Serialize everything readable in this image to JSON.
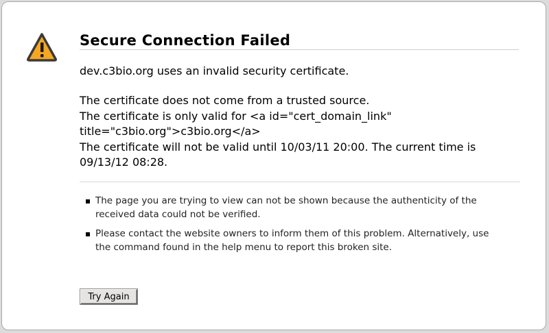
{
  "error": {
    "title": "Secure Connection Failed",
    "icon": "warning-triangle-icon",
    "short_desc": "dev.c3bio.org uses an invalid security certificate.",
    "tech_lines": [
      "The certificate does not come from a trusted source.",
      "The certificate is only valid for <a id=\"cert_domain_link\" title=\"c3bio.org\">c3bio.org</a>",
      "The certificate will not be valid until 10/03/11 20:00. The current time is 09/13/12 08:28."
    ],
    "bullets": [
      "The page you are trying to view can not be shown because the authenticity of the received data could not be verified.",
      "Please contact the website owners to inform them of this problem. Alternatively, use the command found in the help menu to report this broken site."
    ],
    "try_again_label": "Try Again"
  },
  "colors": {
    "icon_fill": "#f5a623",
    "icon_stroke": "#3a3a3a",
    "page_background": "#ffffff"
  }
}
